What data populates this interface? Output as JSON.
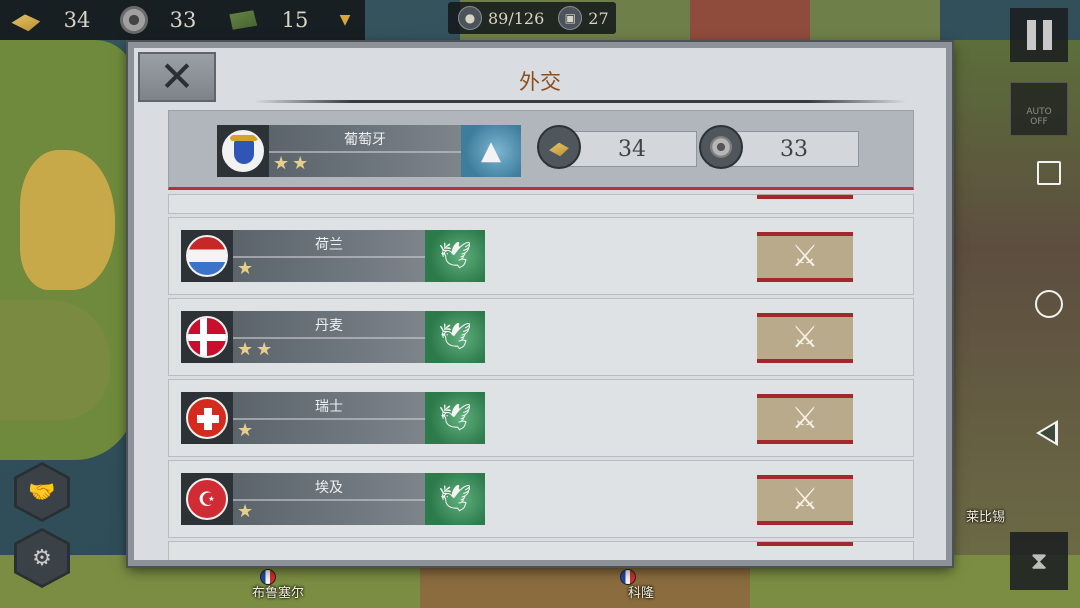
{
  "topbar": {
    "gold": "34",
    "industry": "33",
    "command": "15",
    "population": "89/126",
    "medals": "27"
  },
  "map_labels": {
    "brussels": "布鲁塞尔",
    "cologne": "科隆",
    "leipzig": "莱比锡"
  },
  "side_controls": {
    "auto_label": "AUTO",
    "auto_sub": "OFF"
  },
  "dialog": {
    "title": "外交",
    "player": {
      "name": "葡萄牙",
      "stars": "★★",
      "gold": "34",
      "industry": "33"
    },
    "nations": [
      {
        "name": "荷兰",
        "stars": "★",
        "flag": "netherlands"
      },
      {
        "name": "丹麦",
        "stars": "★★",
        "flag": "denmark"
      },
      {
        "name": "瑞士",
        "stars": "★",
        "flag": "switzerland"
      },
      {
        "name": "埃及",
        "stars": "★",
        "flag": "egypt"
      }
    ]
  },
  "colors": {
    "title": "#8a4f1c",
    "war_stripe": "#a3282c",
    "peace_emblem": "#2d7a4b",
    "hawk_emblem": "#3e7e9d"
  },
  "icons": {
    "close": "close-icon",
    "war": "crossed-swords-icon",
    "peace": "dove-icon",
    "player_emblem": "eagle-icon",
    "diplomacy": "handshake-icon",
    "tech": "wrench-gear-icon"
  }
}
